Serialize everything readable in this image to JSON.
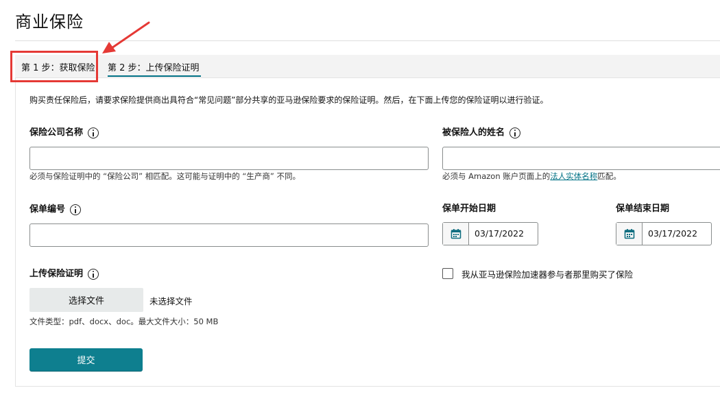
{
  "page": {
    "title": "商业保险"
  },
  "tabs": [
    {
      "label": "第 1 步：获取保险"
    },
    {
      "label": "第 2 步：上传保险证明"
    }
  ],
  "intro_text": "购买责任保险后，请要求保险提供商出具符合“常见问题”部分共享的亚马逊保险要求的保险证明。然后，在下面上传您的保险证明以进行验证。",
  "form": {
    "insurer_name": {
      "label": "保险公司名称",
      "value": "",
      "hint": "必须与保险证明中的 “保险公司” 相匹配。这可能与证明中的 “生产商” 不同。"
    },
    "insured_name": {
      "label": "被保险人的姓名",
      "value": "",
      "hint_prefix": "必须与 Amazon 账户页面上的",
      "hint_link": "法人实体名称",
      "hint_suffix": "匹配。"
    },
    "policy_number": {
      "label": "保单编号",
      "value": ""
    },
    "start_date": {
      "label": "保单开始日期",
      "value": "03/17/2022"
    },
    "end_date": {
      "label": "保单结束日期",
      "value": "03/17/2022"
    },
    "upload": {
      "label": "上传保险证明",
      "button_label": "选择文件",
      "status": "未选择文件",
      "file_types": "文件类型：pdf、docx、doc。最大文件大小：50 MB"
    },
    "accelerator_checkbox": {
      "label": "我从亚马逊保险加速器参与者那里购买了保险",
      "checked": false
    },
    "submit_label": "提交"
  },
  "colors": {
    "accent": "#007185",
    "submit": "#0e7f8f",
    "annotation": "#e53935"
  },
  "icons": {
    "info": "info-circle-icon",
    "calendar": "calendar-icon"
  }
}
